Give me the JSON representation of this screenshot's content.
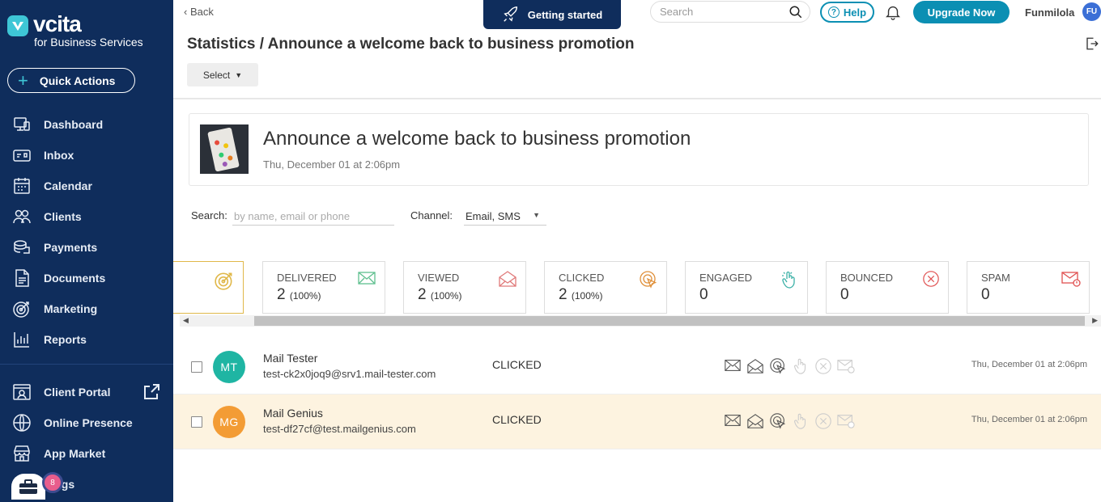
{
  "brand": {
    "name": "vcita",
    "tagline": "for Business Services",
    "accent": "#3ec6d6",
    "sidebar_bg": "#0f2d5c"
  },
  "sidebar": {
    "quick_actions": "Quick Actions",
    "items": [
      {
        "label": "Dashboard",
        "icon": "dashboard-icon"
      },
      {
        "label": "Inbox",
        "icon": "inbox-icon"
      },
      {
        "label": "Calendar",
        "icon": "calendar-icon"
      },
      {
        "label": "Clients",
        "icon": "clients-icon"
      },
      {
        "label": "Payments",
        "icon": "payments-icon"
      },
      {
        "label": "Documents",
        "icon": "documents-icon"
      },
      {
        "label": "Marketing",
        "icon": "marketing-icon"
      },
      {
        "label": "Reports",
        "icon": "reports-icon"
      }
    ],
    "bottom_items": [
      {
        "label": "Client Portal",
        "icon": "client-portal-icon"
      },
      {
        "label": "Online Presence",
        "icon": "globe-icon"
      },
      {
        "label": "App Market",
        "icon": "store-icon"
      },
      {
        "label": "ttings",
        "icon": "settings-icon"
      }
    ],
    "help_badge": "8"
  },
  "topbar": {
    "back": "Back",
    "getting_started": "Getting started",
    "search_placeholder": "Search",
    "help": "Help",
    "upgrade": "Upgrade Now",
    "user_name": "Funmilola",
    "user_initials": "FU"
  },
  "page": {
    "title": "Statistics / Announce a welcome back to business promotion",
    "select": "Select"
  },
  "campaign": {
    "title": "Announce a welcome back to business promotion",
    "date": "Thu, December 01 at 2:06pm"
  },
  "filters": {
    "search_label": "Search:",
    "search_placeholder": "by name, email or phone",
    "channel_label": "Channel:",
    "channel_value": "Email, SMS"
  },
  "stats": [
    {
      "label": "",
      "value": "",
      "pct": "",
      "icon": "target-icon"
    },
    {
      "label": "DELIVERED",
      "value": "2",
      "pct": "(100%)",
      "icon": "envelope-icon"
    },
    {
      "label": "VIEWED",
      "value": "2",
      "pct": "(100%)",
      "icon": "open-envelope-icon"
    },
    {
      "label": "CLICKED",
      "value": "2",
      "pct": "(100%)",
      "icon": "click-icon"
    },
    {
      "label": "ENGAGED",
      "value": "0",
      "pct": "",
      "icon": "hand-pointer-icon"
    },
    {
      "label": "BOUNCED",
      "value": "0",
      "pct": "",
      "icon": "x-circle-icon"
    },
    {
      "label": "SPAM",
      "value": "0",
      "pct": "",
      "icon": "spam-envelope-icon"
    }
  ],
  "recipients": [
    {
      "initials": "MT",
      "name": "Mail Tester",
      "email": "test-ck2x0joq9@srv1.mail-tester.com",
      "status": "CLICKED",
      "date": "Thu, December 01 at 2:06pm",
      "avatar_color": "#1fb5a3"
    },
    {
      "initials": "MG",
      "name": "Mail Genius",
      "email": "test-df27cf@test.mailgenius.com",
      "status": "CLICKED",
      "date": "Thu, December 01 at 2:06pm",
      "avatar_color": "#f39c35"
    }
  ]
}
